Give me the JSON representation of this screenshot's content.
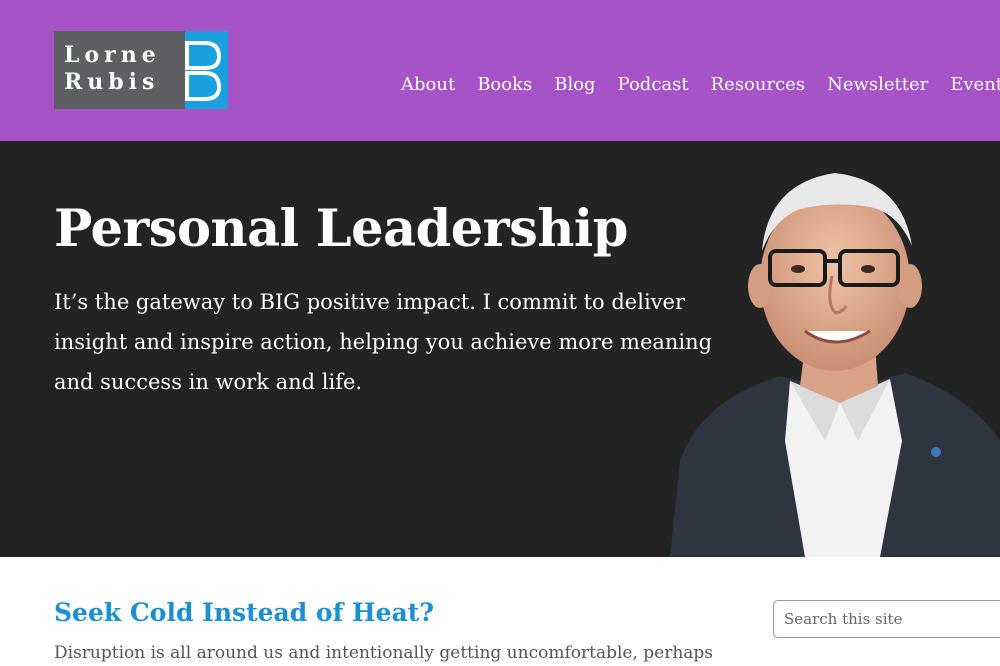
{
  "header": {
    "logo": {
      "line1": "Lorne",
      "line2": "Rubis"
    },
    "nav": [
      "About",
      "Books",
      "Blog",
      "Podcast",
      "Resources",
      "Newsletter",
      "Events"
    ]
  },
  "hero": {
    "title": "Personal Leadership",
    "text": "It’s the gateway to BIG positive impact. I commit to deliver insight and inspire action, helping you achieve more meaning and success in work and life."
  },
  "post": {
    "title": "Seek Cold Instead of Heat?",
    "excerpt": "Disruption is all around us and intentionally getting uncomfortable, perhaps"
  },
  "search": {
    "placeholder": "Search this site",
    "value": ""
  },
  "colors": {
    "header_bg": "#a653c7",
    "hero_bg": "#232323",
    "logo_gray": "#5d5f62",
    "logo_blue": "#1a9fdf",
    "link_blue": "#1b8fd1"
  }
}
